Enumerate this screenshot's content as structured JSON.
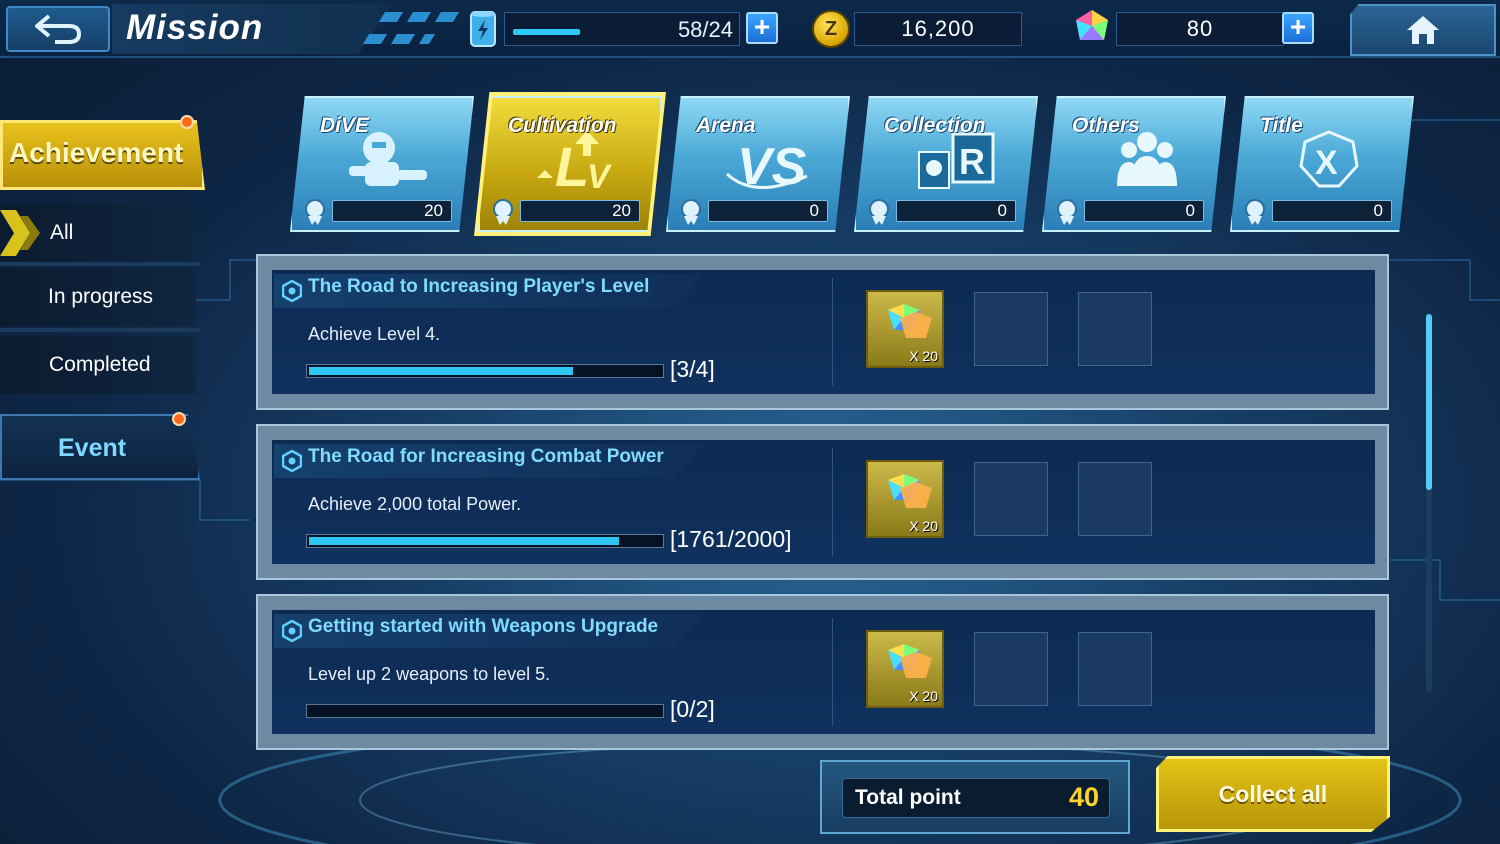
{
  "header": {
    "title": "Mission",
    "energy": {
      "text": "58/24",
      "fill_fraction": 0.55
    },
    "coins": "16,200",
    "gems": "80",
    "coin_symbol": "Z"
  },
  "nav": {
    "achievement": "Achievement",
    "all": "All",
    "in_progress": "In progress",
    "completed": "Completed",
    "event": "Event"
  },
  "categories": [
    {
      "label": "DiVE",
      "count": "20",
      "icon": "robot-icon",
      "active": false
    },
    {
      "label": "Cultivation",
      "count": "20",
      "icon": "level-up-icon",
      "active": true
    },
    {
      "label": "Arena",
      "count": "0",
      "icon": "versus-icon",
      "active": false
    },
    {
      "label": "Collection",
      "count": "0",
      "icon": "collection-icon",
      "active": false
    },
    {
      "label": "Others",
      "count": "0",
      "icon": "people-icon",
      "active": false
    },
    {
      "label": "Title",
      "count": "0",
      "icon": "x-emblem-icon",
      "active": false
    }
  ],
  "missions": [
    {
      "title": "The Road to Increasing Player's Level",
      "desc": "Achieve Level 4.",
      "progress": "[3/4]",
      "progress_fraction": 0.75,
      "reward_qty": "X 20"
    },
    {
      "title": "The Road for Increasing Combat Power",
      "desc": "Achieve 2,000 total Power.",
      "progress": "[1761/2000]",
      "progress_fraction": 0.88,
      "reward_qty": "X 20"
    },
    {
      "title": "Getting started with Weapons Upgrade",
      "desc": "Level up 2 weapons to level 5.",
      "progress": "[0/2]",
      "progress_fraction": 0,
      "reward_qty": "X 20"
    }
  ],
  "footer": {
    "total_label": "Total point",
    "total_value": "40",
    "collect_all": "Collect all"
  },
  "colors": {
    "accent_cyan": "#2ec7f5",
    "accent_yellow": "#e4c316",
    "title_cyan": "#7fdcff",
    "badge_orange": "#ff6a1a"
  }
}
